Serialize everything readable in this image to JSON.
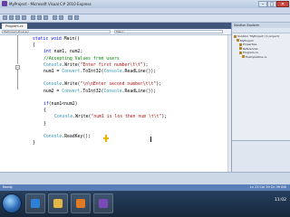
{
  "window": {
    "title": "MyProject - Microsoft Visual C# 2010 Express",
    "buttons": [
      "–",
      "□",
      "✕"
    ]
  },
  "menubar": {
    "items": [
      "File",
      "Edit",
      "View",
      "Project",
      "Debug",
      "Data",
      "Tools",
      "Window",
      "Help"
    ]
  },
  "document_tab": "Program.cs",
  "nav": {
    "left": "MyProject.Program",
    "right": "Main()"
  },
  "code": [
    {
      "indent": 2,
      "tokens": [
        {
          "t": "static ",
          "k": "kw"
        },
        {
          "t": "void ",
          "k": "kw"
        },
        {
          "t": "Main()",
          "k": ""
        }
      ]
    },
    {
      "indent": 2,
      "tokens": [
        {
          "t": "{",
          "k": ""
        }
      ]
    },
    {
      "indent": 3,
      "tokens": [
        {
          "t": "int ",
          "k": "kw"
        },
        {
          "t": "num1, num2;",
          "k": ""
        }
      ]
    },
    {
      "indent": 3,
      "tokens": [
        {
          "t": "//Accepting Values from users",
          "k": "cm"
        }
      ]
    },
    {
      "indent": 3,
      "tokens": [
        {
          "t": "Console",
          "k": "cls"
        },
        {
          "t": ".Write(",
          "k": ""
        },
        {
          "t": "\"Enter first number\\t\\t\"",
          "k": "str"
        },
        {
          "t": ");",
          "k": ""
        }
      ]
    },
    {
      "indent": 3,
      "tokens": [
        {
          "t": "num1 = ",
          "k": ""
        },
        {
          "t": "Convert",
          "k": "cls"
        },
        {
          "t": ".ToInt32(",
          "k": ""
        },
        {
          "t": "Console",
          "k": "cls"
        },
        {
          "t": ".ReadLine());",
          "k": ""
        }
      ]
    },
    {
      "indent": 0,
      "tokens": []
    },
    {
      "indent": 3,
      "tokens": [
        {
          "t": "Console",
          "k": "cls"
        },
        {
          "t": ".Write(",
          "k": ""
        },
        {
          "t": "\"\\n\\nEnter second number\\t\\t\"",
          "k": "str"
        },
        {
          "t": ");",
          "k": ""
        }
      ]
    },
    {
      "indent": 3,
      "tokens": [
        {
          "t": "num2 = ",
          "k": ""
        },
        {
          "t": "Convert",
          "k": "cls"
        },
        {
          "t": ".ToInt32(",
          "k": ""
        },
        {
          "t": "Console",
          "k": "cls"
        },
        {
          "t": ".ReadLine());",
          "k": ""
        }
      ]
    },
    {
      "indent": 0,
      "tokens": []
    },
    {
      "indent": 3,
      "tokens": [
        {
          "t": "if",
          "k": "kw"
        },
        {
          "t": "(num1<num2)",
          "k": ""
        }
      ]
    },
    {
      "indent": 3,
      "tokens": [
        {
          "t": "{",
          "k": ""
        }
      ]
    },
    {
      "indent": 4,
      "tokens": [
        {
          "t": "Console",
          "k": "cls"
        },
        {
          "t": ".Write(",
          "k": ""
        },
        {
          "t": "\"num1 is los then num \\t\\t\"",
          "k": "str"
        },
        {
          "t": ");",
          "k": ""
        }
      ]
    },
    {
      "indent": 3,
      "tokens": [
        {
          "t": "}",
          "k": ""
        }
      ]
    },
    {
      "indent": 0,
      "tokens": []
    },
    {
      "indent": 3,
      "tokens": [
        {
          "t": "Console",
          "k": "cls"
        },
        {
          "t": ".ReadKey();",
          "k": ""
        }
      ]
    },
    {
      "indent": 2,
      "tokens": [
        {
          "t": "}",
          "k": ""
        }
      ]
    }
  ],
  "solution_explorer": {
    "title": "Solution Explorer",
    "items": [
      {
        "label": "Solution 'MyProject' (1 project)",
        "level": 0
      },
      {
        "label": "MyProject",
        "level": 1
      },
      {
        "label": "Properties",
        "level": 2
      },
      {
        "label": "References",
        "level": 2
      },
      {
        "label": "Program.cs",
        "level": 2
      },
      {
        "label": "ExampleOne.cs",
        "level": 3
      }
    ]
  },
  "status": {
    "left": "Ready",
    "right": "Ln 23    Col 39    Ch 39    INS"
  },
  "taskbar": {
    "apps": [
      {
        "name": "ie-icon",
        "color": "#2f7fd6"
      },
      {
        "name": "explorer-icon",
        "color": "#e2b548"
      },
      {
        "name": "media-player-icon",
        "color": "#e07a24"
      },
      {
        "name": "visual-studio-icon",
        "color": "#7a4bb8"
      }
    ],
    "clock_time": "11:02"
  },
  "colors": {
    "keyword": "#0000ff",
    "string": "#a31515",
    "comment": "#008000",
    "type": "#2b91af"
  }
}
